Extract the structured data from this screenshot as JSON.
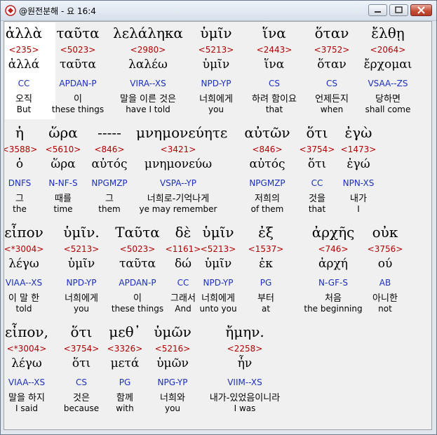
{
  "window": {
    "title": "@원전분해 - 요 16:4"
  },
  "verse_lines": [
    {
      "words": [
        {
          "greek": "ἀλλὰ",
          "strong": "<235>",
          "lemma": "ἀλλά",
          "parse": "CC",
          "korean": "오직",
          "english": "But"
        },
        {
          "greek": "ταῦτα",
          "strong": "<5023>",
          "lemma": "ταῦτα",
          "parse": "APDAN-P",
          "korean": "이",
          "english": "these things"
        },
        {
          "greek": "λελάληκα",
          "strong": "<2980>",
          "lemma": "λαλέω",
          "parse": "VIRA--XS",
          "korean": "말을 이른 것은",
          "english": "have I told"
        },
        {
          "greek": "ὑμῖν",
          "strong": "<5213>",
          "lemma": "ὑμῖν",
          "parse": "NPD-YP",
          "korean": "너희에게",
          "english": "you"
        },
        {
          "greek": "ἵνα",
          "strong": "<2443>",
          "lemma": "ἵνα",
          "parse": "CS",
          "korean": "하려 함이요",
          "english": "that"
        },
        {
          "greek": "ὅταν",
          "strong": "<3752>",
          "lemma": "ὅταν",
          "parse": "CS",
          "korean": "언제든지",
          "english": "when"
        },
        {
          "greek": "ἔλθῃ",
          "strong": "<2064>",
          "lemma": "ἔρχομαι",
          "parse": "VSAA--ZS",
          "korean": "당하면",
          "english": "shall come"
        }
      ]
    },
    {
      "words": [
        {
          "greek": "ἡ",
          "strong": "<3588>",
          "lemma": "ὁ",
          "parse": "DNFS",
          "korean": "그",
          "english": "the"
        },
        {
          "greek": "ὥρα",
          "strong": "<5610>",
          "lemma": "ὥρα",
          "parse": "N-NF-S",
          "korean": "때를",
          "english": "time"
        },
        {
          "greek": "-----",
          "strong": "<846>",
          "lemma": "αὐτός",
          "parse": "NPGMZP",
          "korean": "그",
          "english": "them"
        },
        {
          "greek": "μνημονεύητε",
          "strong": "<3421>",
          "lemma": "μνημονεύω",
          "parse": "VSPA--YP",
          "korean": "너희로-기억나게",
          "english": "ye may remember"
        },
        {
          "greek": "αὐτῶν",
          "strong": "<846>",
          "lemma": "αὐτός",
          "parse": "NPGMZP",
          "korean": "저희의",
          "english": "of them"
        },
        {
          "greek": "ὅτι",
          "strong": "<3754>",
          "lemma": "ὅτι",
          "parse": "CC",
          "korean": "것을",
          "english": "that"
        },
        {
          "greek": "ἐγὼ",
          "strong": "<1473>",
          "lemma": "ἐγώ",
          "parse": "NPN-XS",
          "korean": "내가",
          "english": "I"
        }
      ]
    },
    {
      "words": [
        {
          "greek": "εἶπον",
          "strong": "<*3004>",
          "lemma": "λέγω",
          "parse": "VIAA--XS",
          "korean": "이 말 한",
          "english": "told"
        },
        {
          "greek": "ὑμῖν.",
          "strong": "<5213>",
          "lemma": "ὑμῖν",
          "parse": "NPD-YP",
          "korean": "너희에게",
          "english": "you"
        },
        {
          "greek": "Ταῦτα",
          "strong": "<5023>",
          "lemma": "ταῦτα",
          "parse": "APDAN-P",
          "korean": "이",
          "english": "these things"
        },
        {
          "greek": "δὲ",
          "strong": "<1161>",
          "lemma": "δώ",
          "parse": "CC",
          "korean": "그래서",
          "english": "And"
        },
        {
          "greek": "ὑμῖν",
          "strong": "<5213>",
          "lemma": "ὑμῖν",
          "parse": "NPD-YP",
          "korean": "너희에게",
          "english": "unto you"
        },
        {
          "greek": "ἐξ",
          "strong": "<1537>",
          "lemma": "ἐκ",
          "parse": "PG",
          "korean": "부터",
          "english": "at"
        },
        {
          "greek": "ἀρχῆς",
          "strong": "<746>",
          "lemma": "ἀρχή",
          "parse": "N-GF-S",
          "korean": "처음",
          "english": "the beginning"
        },
        {
          "greek": "οὐκ",
          "strong": "<3756>",
          "lemma": "ού",
          "parse": "AB",
          "korean": "아니한",
          "english": "not"
        }
      ]
    },
    {
      "words": [
        {
          "greek": "εἶπον,",
          "strong": "<*3004>",
          "lemma": "λέγω",
          "parse": "VIAA--XS",
          "korean": "말을 하지",
          "english": "I said"
        },
        {
          "greek": "ὅτι",
          "strong": "<3754>",
          "lemma": "ὅτι",
          "parse": "CS",
          "korean": "것은",
          "english": "because"
        },
        {
          "greek": "μεθ᾽",
          "strong": "<3326>",
          "lemma": "μετά",
          "parse": "PG",
          "korean": "함께",
          "english": "with"
        },
        {
          "greek": "ὑμῶν",
          "strong": "<5216>",
          "lemma": "ὑμῶν",
          "parse": "NPG-YP",
          "korean": "너희와",
          "english": "you"
        },
        {
          "greek": "ἤμην.",
          "strong": "<2258>",
          "lemma": "ἦν",
          "parse": "VIIM--XS",
          "korean": "내가-있었음이니라",
          "english": "I was"
        }
      ]
    }
  ],
  "colors": {
    "strong": "#b00000",
    "parse": "#1a2ec0",
    "selected_bg": "#ffffff"
  },
  "icons": {
    "app": "app-icon",
    "minimize": "minimize-icon",
    "maximize": "maximize-icon",
    "close": "close-icon"
  }
}
